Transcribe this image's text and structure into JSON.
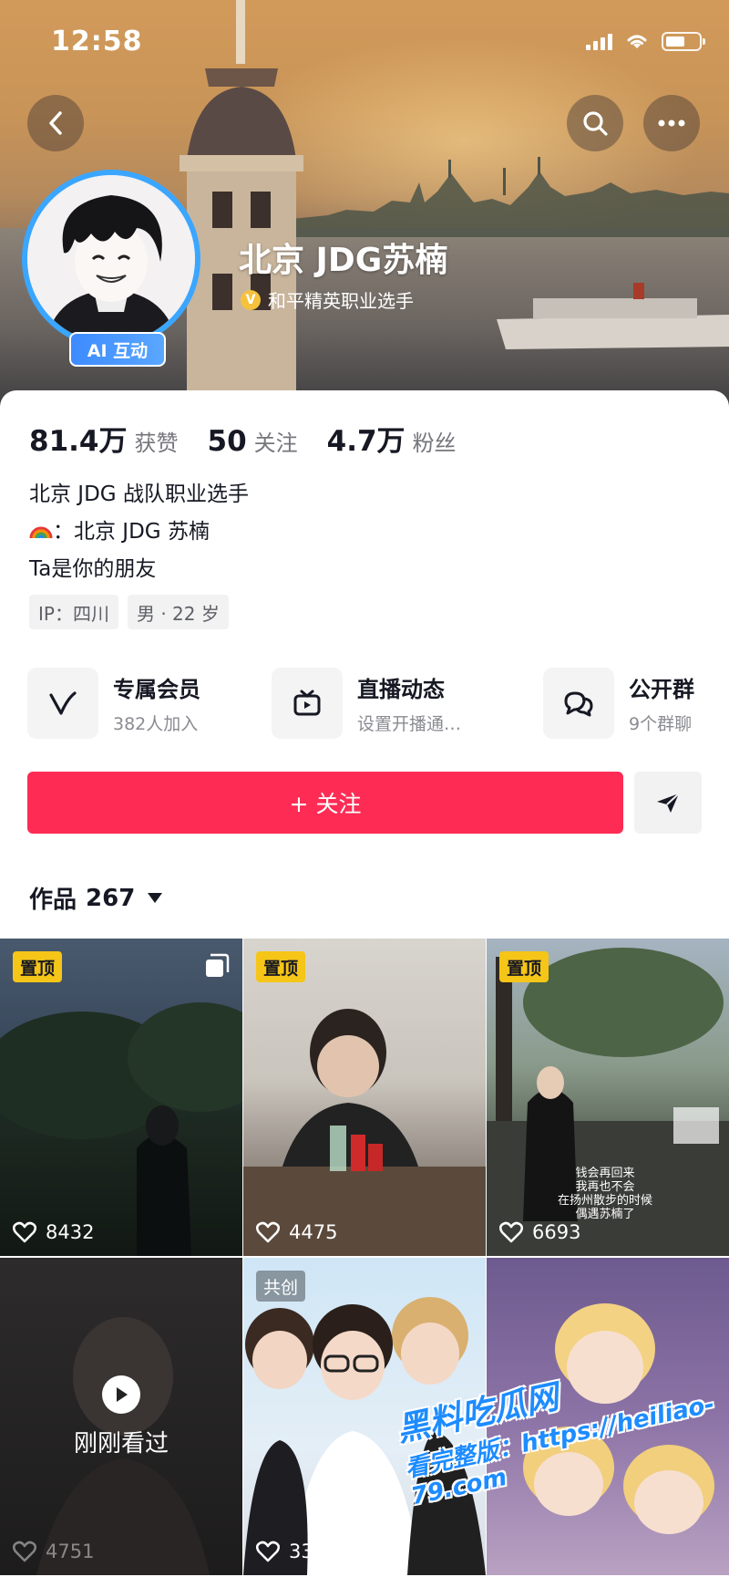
{
  "status_bar": {
    "time": "12:58"
  },
  "profile": {
    "name": "北京 JDG苏楠",
    "verification": "和平精英职业选手",
    "verification_mark": "V",
    "ai_badge": "AI 互动",
    "stats": [
      {
        "value": "81.4万",
        "label": "获赞"
      },
      {
        "value": "50",
        "label": "关注"
      },
      {
        "value": "4.7万",
        "label": "粉丝"
      }
    ],
    "bio_line1": "北京 JDG 战队职业选手",
    "bio_line2": "：北京 JDG 苏楠",
    "bio_line3": "Ta是你的朋友",
    "tags": [
      "IP：四川",
      "男 · 22 岁"
    ]
  },
  "features": [
    {
      "title": "专属会员",
      "subtitle": "382人加入",
      "icon": "v-member-icon"
    },
    {
      "title": "直播动态",
      "subtitle": "设置开播通…",
      "icon": "tv-icon"
    },
    {
      "title": "公开群",
      "subtitle": "9个群聊",
      "icon": "chat-bubbles-icon"
    }
  ],
  "actions": {
    "follow_label": "+ 关注",
    "share_icon": "send-icon"
  },
  "works": {
    "label": "作品",
    "count": "267"
  },
  "videos": [
    {
      "badge": "置顶",
      "likes": "8432",
      "multi": true
    },
    {
      "badge": "置顶",
      "likes": "4475"
    },
    {
      "badge": "置顶",
      "likes": "6693",
      "caption": [
        "钱会再回来",
        "我再也不会",
        "在扬州散步的时候",
        "偶遇苏楠了"
      ]
    },
    {
      "seen_label": "刚刚看过",
      "likes": "4751"
    },
    {
      "co_badge": "共创",
      "likes": "3354"
    },
    {
      "likes": ""
    }
  ],
  "watermark": {
    "line1": "黑料吃瓜网",
    "line2": "看完整版：https://heiliao-79.com"
  },
  "colors": {
    "follow": "#fe2c55",
    "pin": "#f5c518",
    "avatar_ring": "#3aa6ff"
  }
}
